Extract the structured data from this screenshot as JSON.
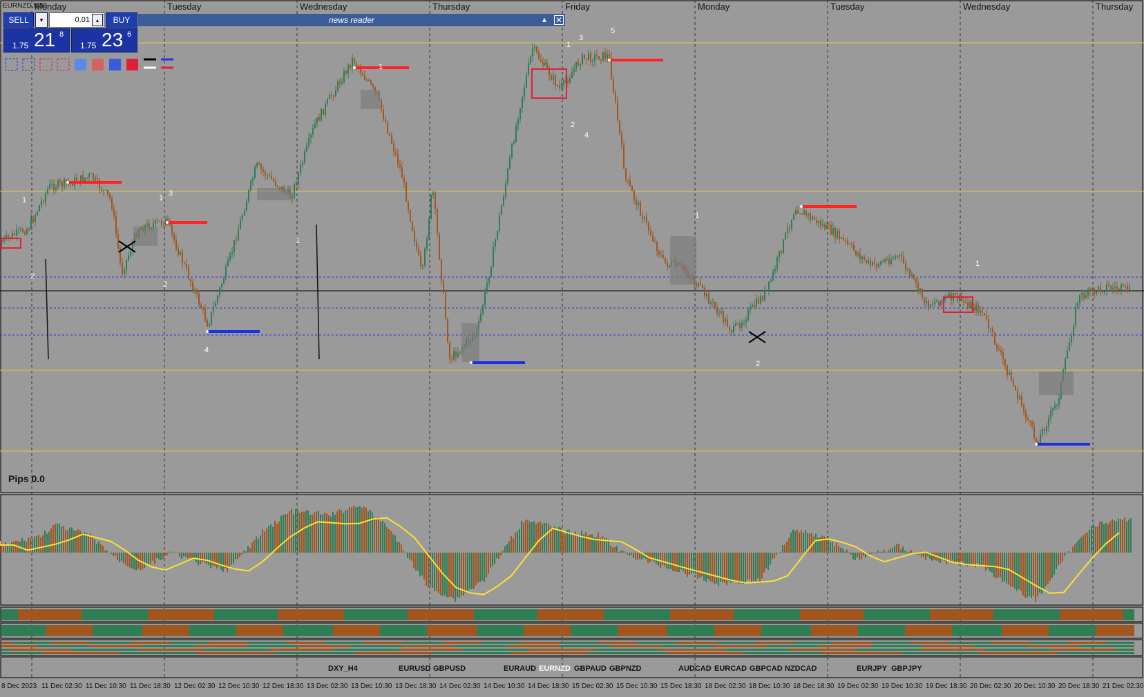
{
  "window": {
    "title": "EURNZD,M30"
  },
  "trade_panel": {
    "sell_label": "SELL",
    "buy_label": "BUY",
    "lot_value": "0.01",
    "sell_price": {
      "prefix": "1.75",
      "big": "21",
      "sup": "8"
    },
    "buy_price": {
      "prefix": "1.75",
      "big": "23",
      "sup": "6"
    }
  },
  "news_reader": {
    "title": "news reader"
  },
  "pips_label": "Pips 0.0",
  "day_labels": [
    "Monday",
    "Tuesday",
    "Wednesday",
    "Thursday",
    "Friday",
    "Monday",
    "Tuesday",
    "Wednesday",
    "Thursday"
  ],
  "time_labels": [
    "8 Dec 2023",
    "11 Dec 02:30",
    "11 Dec 10:30",
    "11 Dec 18:30",
    "12 Dec 02:30",
    "12 Dec 10:30",
    "12 Dec 18:30",
    "13 Dec 02:30",
    "13 Dec 10:30",
    "13 Dec 18:30",
    "14 Dec 02:30",
    "14 Dec 10:30",
    "14 Dec 18:30",
    "15 Dec 02:30",
    "15 Dec 10:30",
    "15 Dec 18:30",
    "18 Dec 02:30",
    "18 Dec 10:30",
    "18 Dec 18:30",
    "19 Dec 02:30",
    "19 Dec 10:30",
    "19 Dec 18:30",
    "20 Dec 02:30",
    "20 Dec 10:30",
    "20 Dec 18:30",
    "21 Dec 02:30"
  ],
  "symbols": [
    "DXY_H4",
    "EURUSD",
    "GBPUSD",
    "EURAUD",
    "EURNZD",
    "GBPAUD",
    "GBPNZD",
    "AUDCAD",
    "EURCAD",
    "GBPCAD",
    "NZDCAD",
    "EURJPY",
    "GBPJPY"
  ],
  "active_symbol": "EURNZD",
  "colors": {
    "background": "#9a9a9a",
    "bull": "#2e7d55",
    "bear": "#a0561e",
    "level_line": "#e6c84a",
    "resistance": "#ff2222",
    "support": "#1a2ee8",
    "signal": "#ffe033"
  },
  "wave_labels": [
    "1",
    "2",
    "3",
    "4",
    "5"
  ]
}
